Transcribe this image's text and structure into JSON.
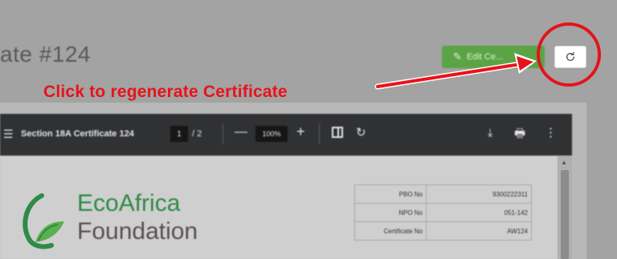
{
  "header": {
    "title": "ate #124",
    "edit_button_label": "Edit Ce..."
  },
  "annotation": {
    "text": "Click to regenerate Certificate",
    "color": "#e8131a"
  },
  "viewer": {
    "document_title": "Section 18A Certificate 124",
    "current_page": "1",
    "page_count": "/ 2",
    "zoom": "100%",
    "zoom_out": "—",
    "zoom_in": "+"
  },
  "document": {
    "org_name_line1": "EcoAfrica",
    "org_name_line2": "Foundation",
    "info_rows": [
      {
        "label": "PBO No",
        "value": "9300222311"
      },
      {
        "label": "NPO No",
        "value": "051-142"
      },
      {
        "label": "Certificate No",
        "value": "AW124"
      }
    ]
  },
  "colors": {
    "accent_green": "#5aa445",
    "highlight_red": "#e2141c",
    "logo_green": "#2f8a47",
    "logo_text_dark": "#5a4f57"
  },
  "icons": [
    "pencil-icon",
    "refresh-icon",
    "menu-icon",
    "fit-page-icon",
    "rotate-icon",
    "download-icon",
    "print-icon",
    "more-icon",
    "leaf-logo-icon"
  ]
}
